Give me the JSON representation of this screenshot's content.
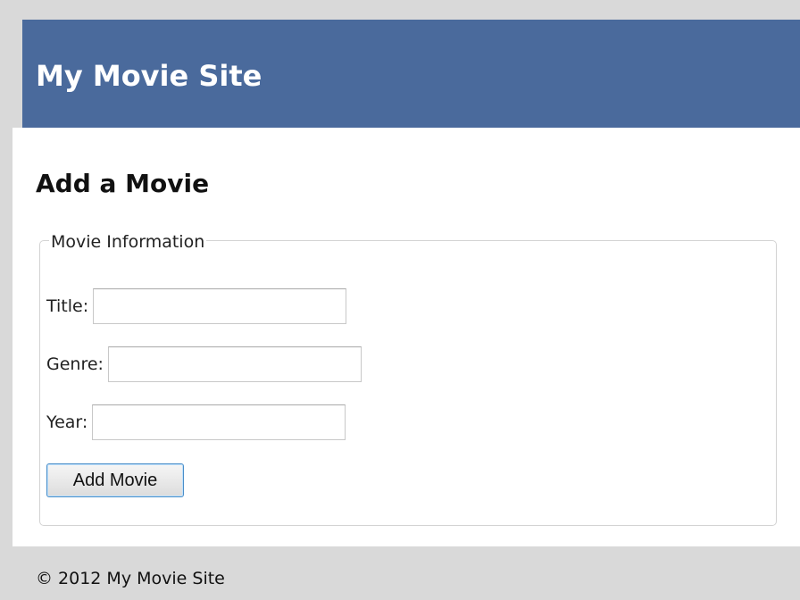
{
  "header": {
    "site_title": "My Movie Site"
  },
  "main": {
    "heading": "Add a Movie",
    "fieldset": {
      "legend": "Movie Information",
      "fields": [
        {
          "label": "Title:",
          "value": ""
        },
        {
          "label": "Genre:",
          "value": ""
        },
        {
          "label": "Year:",
          "value": ""
        }
      ],
      "submit_label": "Add Movie"
    }
  },
  "footer": {
    "copyright": "© 2012 My Movie Site"
  },
  "colors": {
    "header_background": "#4a6a9c",
    "page_background": "#d9d9d9",
    "content_background": "#ffffff",
    "button_border": "#4b8fc9"
  }
}
